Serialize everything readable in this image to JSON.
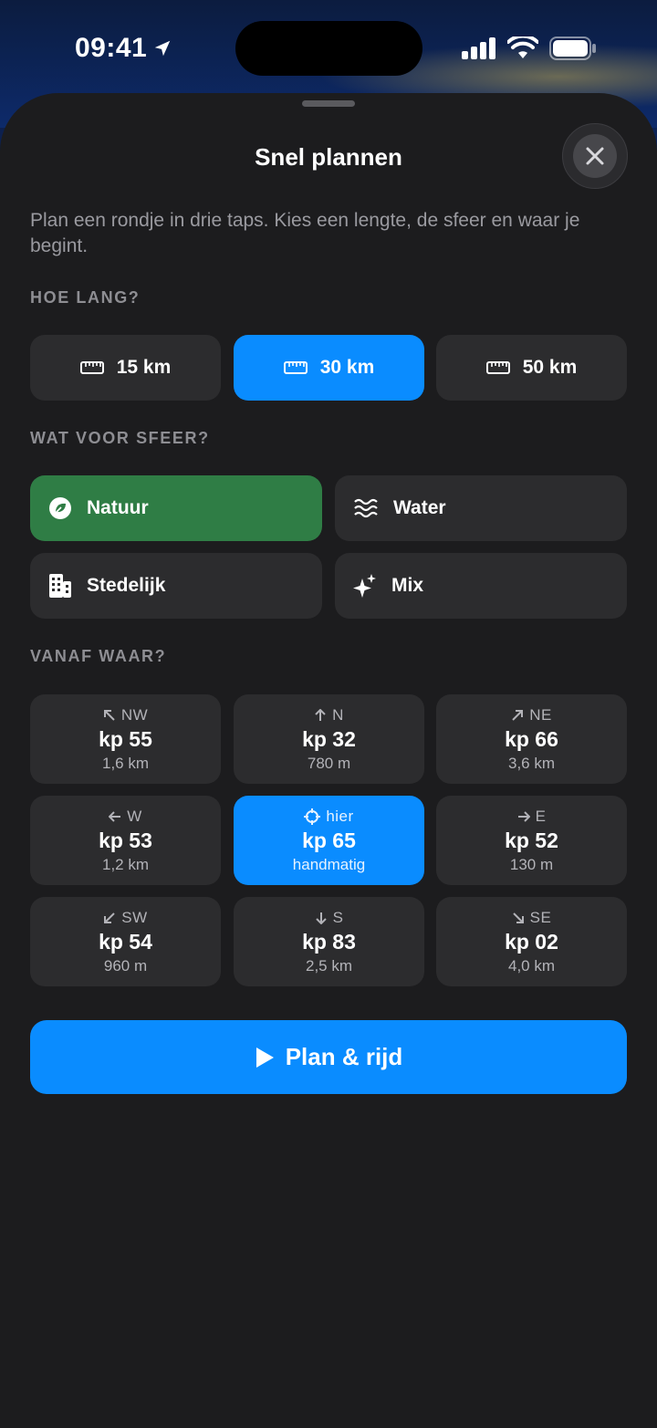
{
  "status_bar": {
    "time": "09:41"
  },
  "sheet": {
    "title": "Snel plannen",
    "description": "Plan een rondje in drie taps. Kies een lengte, de sfeer en waar je begint."
  },
  "length": {
    "label": "HOE LANG?",
    "options": [
      {
        "label": "15 km",
        "selected": false
      },
      {
        "label": "30 km",
        "selected": true
      },
      {
        "label": "50 km",
        "selected": false
      }
    ]
  },
  "mood": {
    "label": "WAT VOOR SFEER?",
    "options": [
      {
        "label": "Natuur",
        "icon": "leaf-icon",
        "selected": true
      },
      {
        "label": "Water",
        "icon": "waves-icon",
        "selected": false
      },
      {
        "label": "Stedelijk",
        "icon": "building-icon",
        "selected": false
      },
      {
        "label": "Mix",
        "icon": "sparkles-icon",
        "selected": false
      }
    ]
  },
  "start": {
    "label": "VANAF WAAR?",
    "options": [
      {
        "dir": "NW",
        "kp": "kp 55",
        "dist": "1,6 km",
        "icon": "arrow-up-left-icon"
      },
      {
        "dir": "N",
        "kp": "kp 32",
        "dist": "780 m",
        "icon": "arrow-up-icon"
      },
      {
        "dir": "NE",
        "kp": "kp 66",
        "dist": "3,6 km",
        "icon": "arrow-up-right-icon"
      },
      {
        "dir": "W",
        "kp": "kp 53",
        "dist": "1,2 km",
        "icon": "arrow-left-icon"
      },
      {
        "dir": "hier",
        "kp": "kp 65",
        "dist": "handmatig",
        "icon": "crosshair-icon",
        "selected": true
      },
      {
        "dir": "E",
        "kp": "kp 52",
        "dist": "130 m",
        "icon": "arrow-right-icon"
      },
      {
        "dir": "SW",
        "kp": "kp 54",
        "dist": "960 m",
        "icon": "arrow-down-left-icon"
      },
      {
        "dir": "S",
        "kp": "kp 83",
        "dist": "2,5 km",
        "icon": "arrow-down-icon"
      },
      {
        "dir": "SE",
        "kp": "kp 02",
        "dist": "4,0 km",
        "icon": "arrow-down-right-icon"
      }
    ]
  },
  "action": {
    "label": "Plan & rijd",
    "icon": "play-icon"
  },
  "colors": {
    "accent": "#0a8cff",
    "nature": "#2f7d45",
    "sheet": "#1c1c1e",
    "card": "#2c2c2e"
  }
}
